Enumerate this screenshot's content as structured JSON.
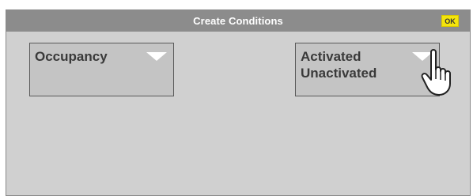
{
  "dialog": {
    "title": "Create Conditions",
    "ok_label": "OK"
  },
  "dropdowns": [
    {
      "label": "Occupancy",
      "options": []
    },
    {
      "label": "",
      "options": [
        "Activated",
        "Unactivated"
      ]
    }
  ],
  "colors": {
    "title_bar": "#8c8c8c",
    "background": "#d0d0d0",
    "dropdown": "#c4c4c4",
    "ok_button": "#f4e40c"
  },
  "icons": {
    "dropdown_arrow": "triangle-down-icon",
    "pointer": "hand-pointer-icon"
  }
}
